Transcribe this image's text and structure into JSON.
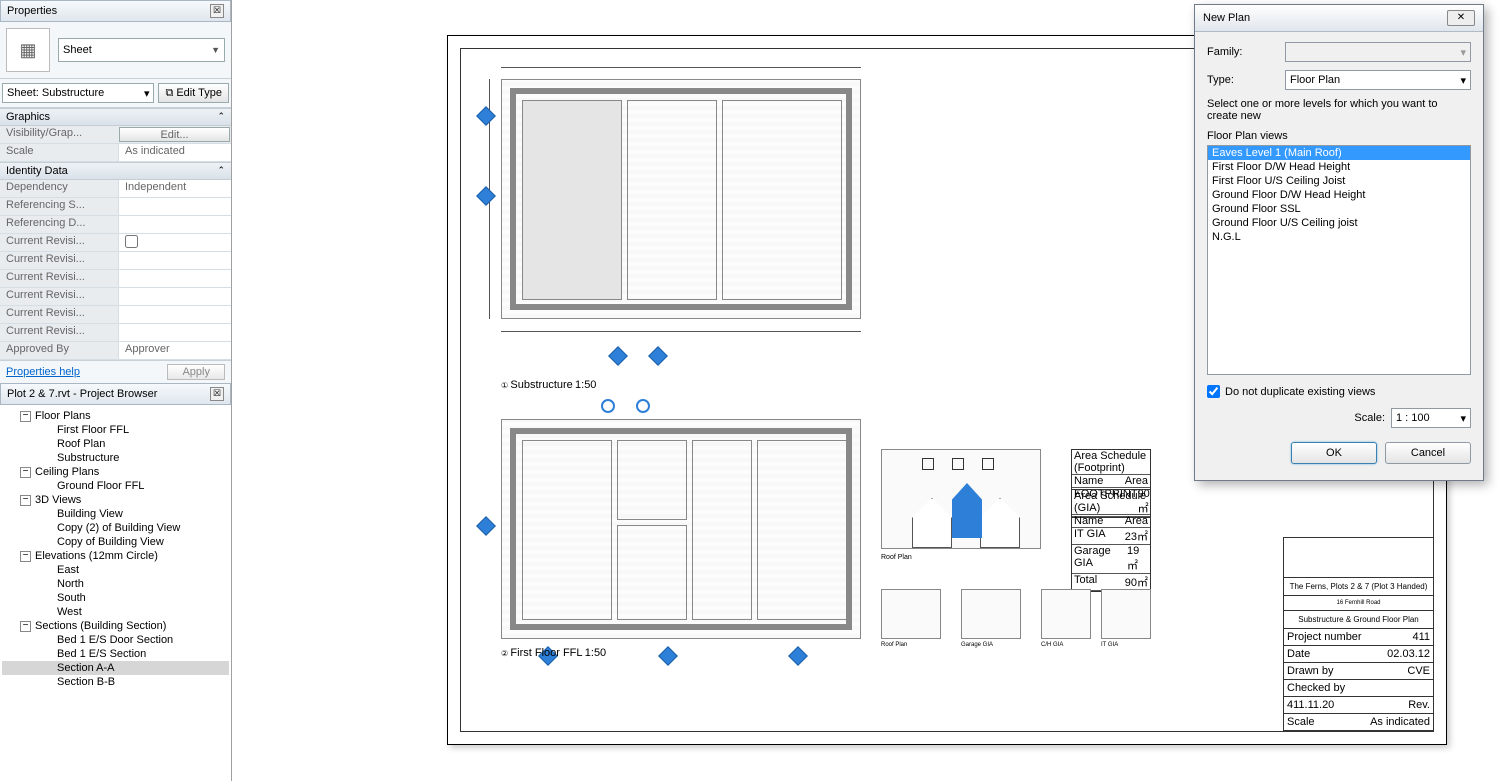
{
  "properties": {
    "title": "Properties",
    "type_label": "Sheet",
    "instance": "Sheet: Substructure",
    "edit_type": "Edit Type",
    "edit_type_icon": "⧉",
    "groups": [
      {
        "name": "Graphics",
        "rows": [
          {
            "label": "Visibility/Grap...",
            "value": "Edit...",
            "is_button": true
          },
          {
            "label": "Scale",
            "value": "As indicated"
          }
        ]
      },
      {
        "name": "Identity Data",
        "rows": [
          {
            "label": "Dependency",
            "value": "Independent"
          },
          {
            "label": "Referencing S...",
            "value": ""
          },
          {
            "label": "Referencing D...",
            "value": ""
          },
          {
            "label": "Current Revisi...",
            "value": "",
            "checkbox": true
          },
          {
            "label": "Current Revisi...",
            "value": ""
          },
          {
            "label": "Current Revisi...",
            "value": ""
          },
          {
            "label": "Current Revisi...",
            "value": ""
          },
          {
            "label": "Current Revisi...",
            "value": ""
          },
          {
            "label": "Current Revisi...",
            "value": ""
          },
          {
            "label": "Approved By",
            "value": "Approver"
          }
        ]
      }
    ],
    "help_link": "Properties help",
    "apply": "Apply"
  },
  "browser": {
    "title": "Plot 2 & 7.rvt - Project Browser",
    "tree": [
      {
        "level": 1,
        "expand": "-",
        "label": "Floor Plans"
      },
      {
        "level": 2,
        "label": "First Floor FFL"
      },
      {
        "level": 2,
        "label": "Roof Plan"
      },
      {
        "level": 2,
        "label": "Substructure"
      },
      {
        "level": 1,
        "expand": "-",
        "label": "Ceiling Plans"
      },
      {
        "level": 2,
        "label": "Ground Floor FFL"
      },
      {
        "level": 1,
        "expand": "-",
        "label": "3D Views"
      },
      {
        "level": 2,
        "label": "Building View"
      },
      {
        "level": 2,
        "label": "Copy (2) of Building View"
      },
      {
        "level": 2,
        "label": "Copy of Building View"
      },
      {
        "level": 1,
        "expand": "-",
        "label": "Elevations (12mm Circle)"
      },
      {
        "level": 2,
        "label": "East"
      },
      {
        "level": 2,
        "label": "North"
      },
      {
        "level": 2,
        "label": "South"
      },
      {
        "level": 2,
        "label": "West"
      },
      {
        "level": 1,
        "expand": "-",
        "label": "Sections (Building Section)"
      },
      {
        "level": 2,
        "label": "Bed 1 E/S Door Section"
      },
      {
        "level": 2,
        "label": "Bed 1 E/S Section"
      },
      {
        "level": 2,
        "label": "Section A-A",
        "selected": true
      },
      {
        "level": 2,
        "label": "Section B-B"
      }
    ]
  },
  "dialog": {
    "title": "New Plan",
    "family_label": "Family:",
    "family_value": "",
    "type_label": "Type:",
    "type_value": "Floor Plan",
    "instruction": "Select one or more levels for which you want to create new",
    "list_label": "Floor Plan views",
    "levels": [
      "Eaves Level 1 (Main Roof)",
      "First Floor D/W Head Height",
      "First Floor U/S Ceiling Joist",
      "Ground Floor D/W Head Height",
      "Ground Floor SSL",
      "Ground Floor U/S Ceiling joist",
      "N.G.L"
    ],
    "selected_index": 0,
    "checkbox_label": "Do not duplicate existing views",
    "checkbox_checked": true,
    "scale_label": "Scale:",
    "scale_value": "1 : 100",
    "ok": "OK",
    "cancel": "Cancel"
  },
  "sheet": {
    "view1_title": "Substructure",
    "view1_scale": "1:50",
    "view2_title": "First Floor FFL",
    "view2_scale": "1:50",
    "elev_title": "Roof Plan",
    "mini1": "Roof Plan",
    "mini2": "Garage GIA",
    "mini3": "C/H GIA",
    "mini4": "IT GIA",
    "titleblock": {
      "project": "The Ferns, Plots 2 & 7 (Plot 3 Handed)",
      "address": "16 Fernhill Road",
      "sheet_name": "Substructure & Ground Floor Plan",
      "project_no_label": "Project number",
      "project_no": "411",
      "date_label": "Date",
      "date": "02.03.12",
      "drawn_label": "Drawn by",
      "drawn": "CVE",
      "checked_label": "Checked by",
      "checked": "",
      "number": "411.11.20",
      "rev_label": "Rev.",
      "scale_label": "Scale",
      "scale": "As indicated"
    },
    "schedule1_title": "Area Schedule (Footprint)",
    "schedule2_title": "Area Schedule (GIA)"
  }
}
